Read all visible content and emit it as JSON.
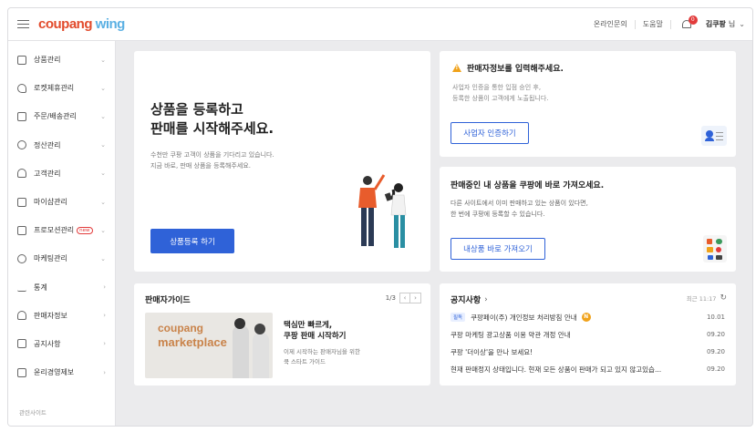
{
  "header": {
    "logo_part1": "coupang",
    "logo_part2": " wing",
    "links": [
      "온라인문의",
      "도움말"
    ],
    "notification_count": "0",
    "user_name": "김쿠팡",
    "user_suffix": "님"
  },
  "sidebar": {
    "items": [
      {
        "label": "상품관리",
        "icon": "box-icon"
      },
      {
        "label": "로켓제휴관리",
        "icon": "rocket-icon"
      },
      {
        "label": "주문/배송관리",
        "icon": "truck-icon"
      },
      {
        "label": "정산관리",
        "icon": "coin-icon"
      },
      {
        "label": "고객관리",
        "icon": "headset-icon"
      },
      {
        "label": "마이샵관리",
        "icon": "shop-icon"
      },
      {
        "label": "프로모션관리",
        "icon": "promotion-icon",
        "badge": "new"
      },
      {
        "label": "마케팅관리",
        "icon": "clock-icon"
      },
      {
        "label": "통계",
        "icon": "bar-chart-icon"
      },
      {
        "label": "판매자정보",
        "icon": "person-icon"
      },
      {
        "label": "공지사항",
        "icon": "megaphone-icon"
      },
      {
        "label": "윤리경영제보",
        "icon": "report-icon"
      }
    ],
    "footer": "관련사이트"
  },
  "hero": {
    "title_line1": "상품을 등록하고",
    "title_line2": "판매를 시작해주세요.",
    "desc_line1": "수천만 쿠팡 고객이 상품을 기다리고 있습니다.",
    "desc_line2": "지금 바로, 판매 상품을 등록해주세요.",
    "button": "상품등록 하기"
  },
  "seller_info": {
    "title": "판매자정보를 입력해주세요.",
    "desc_line1": "사업자 인증을 통한 입점 승인 후,",
    "desc_line2": "등록한 상품이 고객에게 노출됩니다.",
    "button": "사업자 인증하기"
  },
  "import": {
    "title": "판매중인 내 상품을 쿠팡에 바로 가져오세요.",
    "desc_line1": "다른 사이트에서 이미 판매하고 있는 상품이 있다면,",
    "desc_line2": "한 번에 쿠팡에 등록할 수 있습니다.",
    "button": "내상품 바로 가져오기"
  },
  "guide": {
    "title": "판매자가이드",
    "page": "1/3",
    "image_text1": "coupang",
    "image_text2": "marketplace",
    "headline1": "택심만 빠르게,",
    "headline2": "쿠팡 판매 시작하기",
    "desc_line1": "이제 시작하는 판매자님을 위한",
    "desc_line2": "쿡 스타트 가이드"
  },
  "notice": {
    "title": "공지사항",
    "updated": "최근 11:17",
    "rows": [
      {
        "tag": "필독",
        "text": "쿠팡페이(주) 개인정보 처리방침 안내",
        "new": "N",
        "date": "10.01"
      },
      {
        "tag": "",
        "text": "쿠팡 마케팅 광고상품 이용 약관 개정 안내",
        "new": "",
        "date": "09.20"
      },
      {
        "tag": "",
        "text": "쿠팡 '더이상'을 만나 보세요!",
        "new": "",
        "date": "09.20"
      },
      {
        "tag": "",
        "text": "현재 판매정지 상태입니다. 현재 모든 상품이 판매가 되고 있지 않고있습...",
        "new": "",
        "date": "09.20"
      }
    ]
  },
  "colors": {
    "brand_blue": "#2f62d8",
    "warn": "#f0a21a",
    "badge": "#e23b3b"
  }
}
